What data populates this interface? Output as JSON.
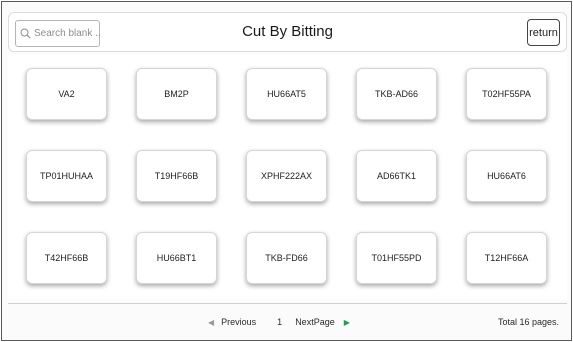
{
  "header": {
    "title": "Cut By Bitting",
    "search_placeholder": "Search blank ...",
    "return_label": "return"
  },
  "keys": [
    "VA2",
    "BM2P",
    "HU66AT5",
    "TKB-AD66",
    "T02HF55PA",
    "TP01HUHAA",
    "T19HF66B",
    "XPHF222AX",
    "AD66TK1",
    "HU66AT6",
    "T42HF66B",
    "HU66BT1",
    "TKB-FD66",
    "T01HF55PD",
    "T12HF66A"
  ],
  "pagination": {
    "previous_label": "Previous",
    "current_page": "1",
    "next_label": "NextPage",
    "total_text": "Total 16 pages."
  },
  "colors": {
    "next_arrow": "#1aa34a",
    "prev_arrow": "#9a9a9a"
  }
}
